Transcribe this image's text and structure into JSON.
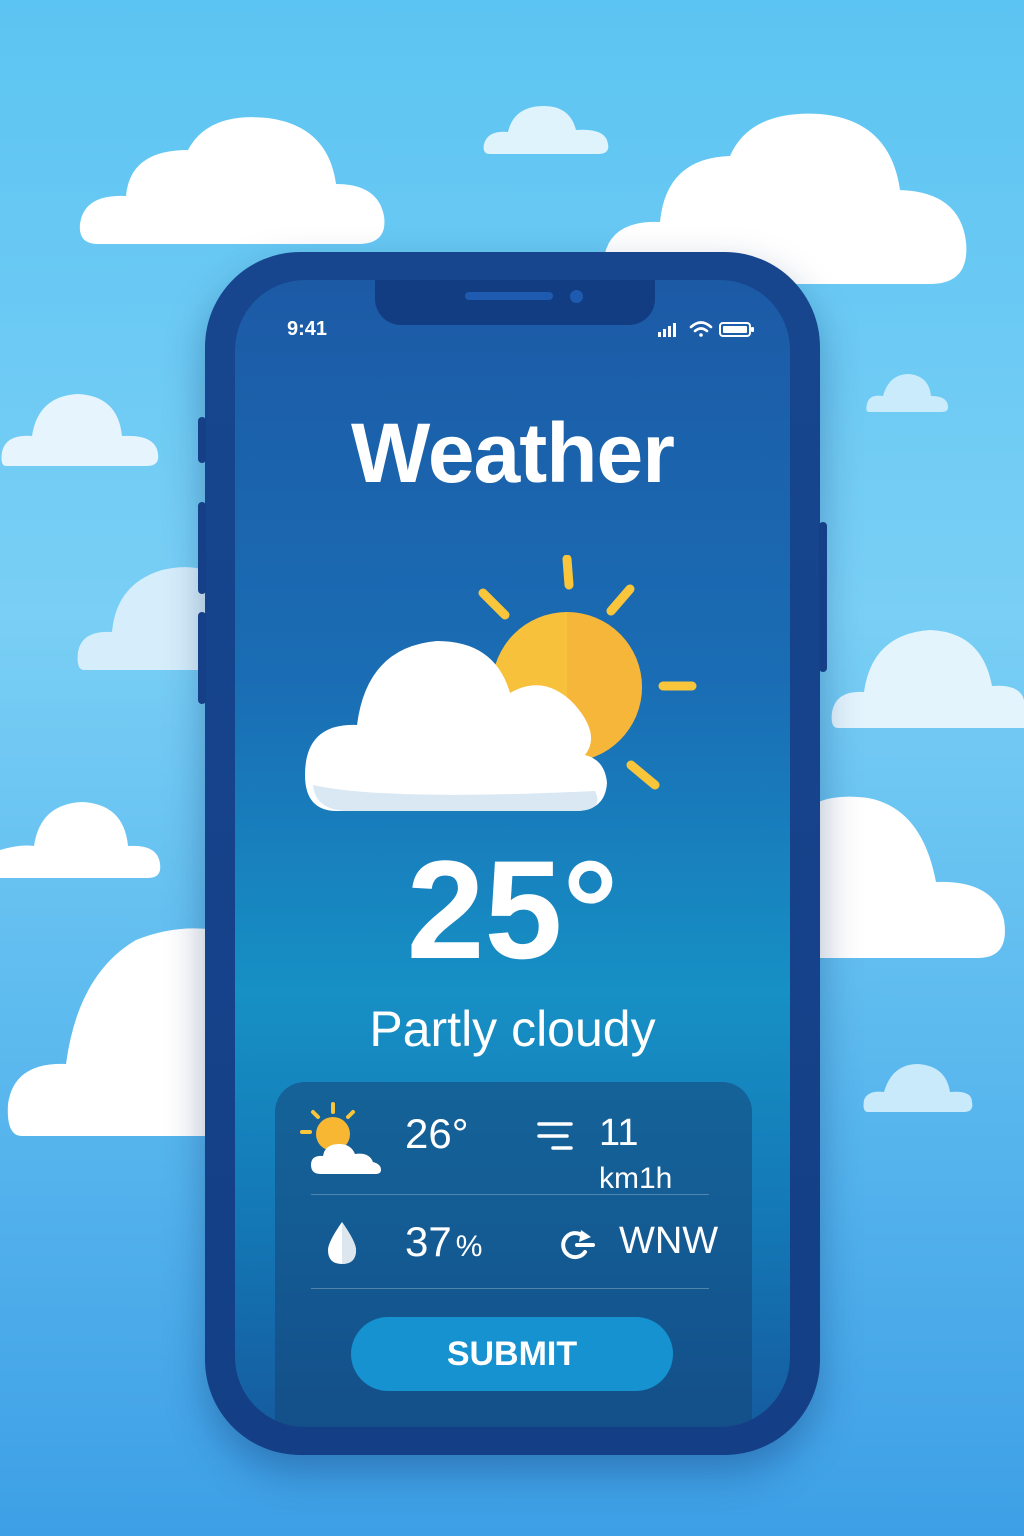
{
  "status_bar": {
    "time": "9:41"
  },
  "app": {
    "title": "Weather"
  },
  "current": {
    "temperature": "25°",
    "condition": "Partly cloudy",
    "icon": "partly-cloudy-icon"
  },
  "details": {
    "high_temp": "26°",
    "wind_speed_value": "11",
    "wind_speed_unit": "km1h",
    "humidity_value": "37",
    "humidity_unit": "%",
    "wind_direction": "WNW"
  },
  "actions": {
    "submit_label": "SUBMIT"
  },
  "colors": {
    "sun": "#f9c53a",
    "accent": "#1592cf",
    "phone": "#17468f"
  }
}
